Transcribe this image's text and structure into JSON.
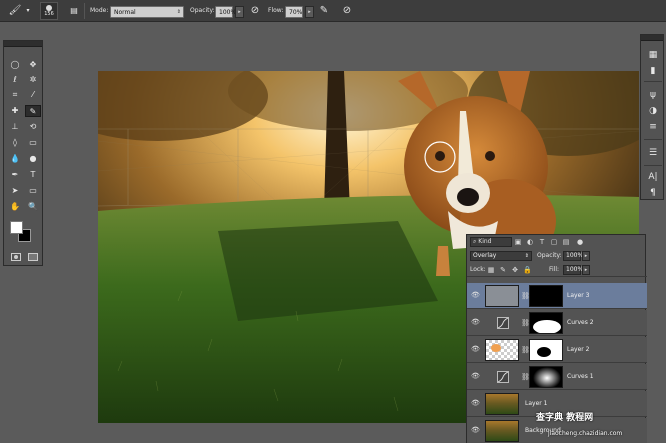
{
  "options_bar": {
    "brush_size": "156",
    "mode_label": "Mode:",
    "mode_value": "Normal",
    "opacity_label": "Opacity:",
    "opacity_value": "100%",
    "flow_label": "Flow:",
    "flow_value": "70%"
  },
  "layers_panel": {
    "filter_kind": "Kind",
    "blend_mode": "Overlay",
    "opacity_label": "Opacity:",
    "opacity_value": "100%",
    "lock_label": "Lock:",
    "fill_label": "Fill:",
    "fill_value": "100%",
    "layers": [
      {
        "name": "Layer 3",
        "selected": true
      },
      {
        "name": "Curves 2",
        "selected": false
      },
      {
        "name": "Layer 2",
        "selected": false
      },
      {
        "name": "Curves 1",
        "selected": false
      },
      {
        "name": "Layer 1",
        "selected": false
      },
      {
        "name": "Background",
        "selected": false
      }
    ]
  },
  "colors": {
    "foreground": "#ffffff",
    "background": "#000000",
    "selection": "#6b7d9c"
  },
  "watermark": {
    "line1": "查字典 教程网",
    "line2": "jiaocheng.chazidian.com"
  }
}
